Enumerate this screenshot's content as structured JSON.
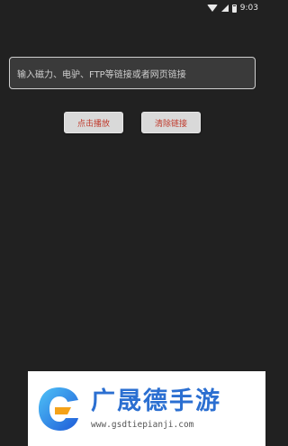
{
  "status_bar": {
    "time": "9:03"
  },
  "url_input": {
    "placeholder": "输入磁力、电驴、FTP等链接或者网页链接"
  },
  "buttons": {
    "play": "点击播放",
    "clear": "清除链接"
  },
  "watermark": {
    "title": "广晟德手游",
    "url": "www.gsdtiepianji.com"
  },
  "colors": {
    "background": "#212121",
    "button_text": "#c0392b",
    "watermark_brand": "#2b6fd1"
  }
}
